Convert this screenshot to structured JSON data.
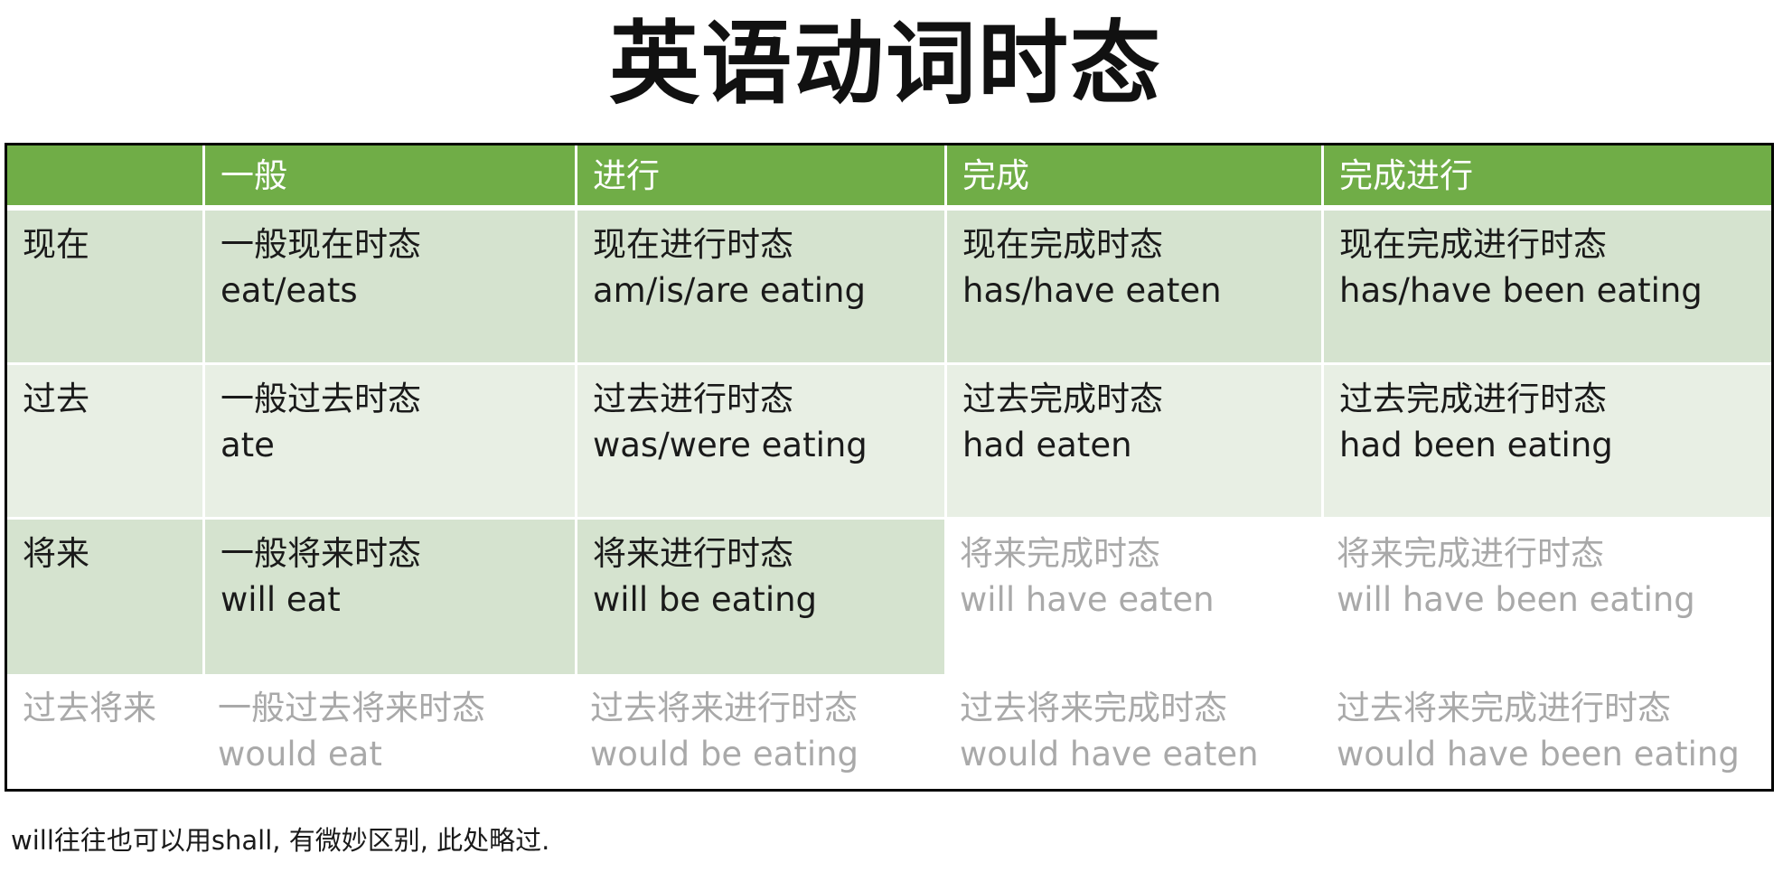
{
  "title": "英语动词时态",
  "header": [
    "",
    "一般",
    "进行",
    "完成",
    "完成进行"
  ],
  "rows": [
    {
      "label": "现在",
      "cells": [
        {
          "name": "一般现在时态",
          "form": "eat/eats"
        },
        {
          "name": "现在进行时态",
          "form": "am/is/are eating"
        },
        {
          "name": "现在完成时态",
          "form": "has/have eaten"
        },
        {
          "name": "现在完成进行时态",
          "form": "has/have been eating"
        }
      ]
    },
    {
      "label": "过去",
      "cells": [
        {
          "name": "一般过去时态",
          "form": "ate"
        },
        {
          "name": "过去进行时态",
          "form": "was/were eating"
        },
        {
          "name": "过去完成时态",
          "form": "had eaten"
        },
        {
          "name": "过去完成进行时态",
          "form": "had been eating"
        }
      ]
    },
    {
      "label": "将来",
      "cells": [
        {
          "name": "一般将来时态",
          "form": "will eat"
        },
        {
          "name": "将来进行时态",
          "form": "will be eating"
        },
        {
          "name": "将来完成时态",
          "form": "will have eaten"
        },
        {
          "name": "将来完成进行时态",
          "form": "will have been eating"
        }
      ]
    },
    {
      "label": "过去将来",
      "cells": [
        {
          "name": "一般过去将来时态",
          "form": "would eat"
        },
        {
          "name": "过去将来进行时态",
          "form": "would be eating"
        },
        {
          "name": "过去将来完成时态",
          "form": "would have eaten"
        },
        {
          "name": "过去将来完成进行时态",
          "form": "would have been eating"
        }
      ]
    }
  ],
  "colors": {
    "header_green": "#70ad47",
    "fill_dark": "#d5e3cf",
    "fill_light": "#e8efe4",
    "muted_text": "#a9a9a9"
  },
  "footnote": "will往往也可以用shall, 有微妙区别, 此处略过."
}
